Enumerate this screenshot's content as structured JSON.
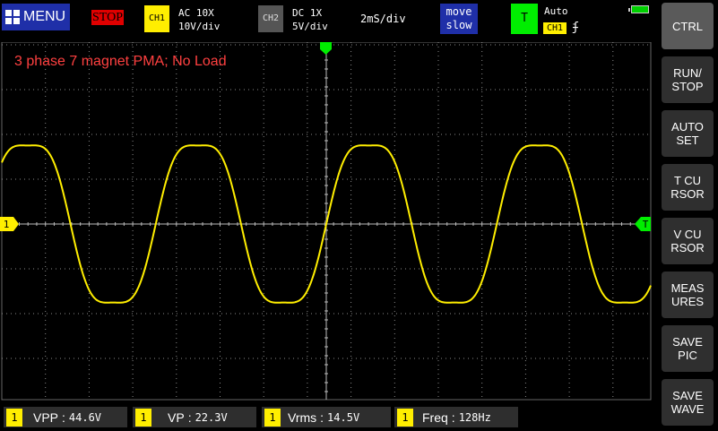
{
  "topbar": {
    "menu_label": "MENU",
    "run_state": "STOP",
    "ch1": {
      "badge": "CH1",
      "coupling": "AC  10X",
      "scale": "10V/div",
      "color": "#ffee00"
    },
    "ch2": {
      "badge": "CH2",
      "coupling": "DC  1X",
      "scale": "5V/div"
    },
    "timebase": "2mS/div",
    "move": {
      "line1": "move",
      "line2": "slow"
    },
    "trigger": {
      "badge": "T",
      "mode": "Auto",
      "source": "CH1",
      "edge_symbol": "ʄ",
      "color": "#00ee00"
    }
  },
  "plot": {
    "annotation": "3 phase 7 magnet PMA; No Load",
    "ch1_marker": "1",
    "trigger_marker": "T"
  },
  "measurements": [
    {
      "channel": "1",
      "label": "VPP",
      "value": "44.6V"
    },
    {
      "channel": "1",
      "label": "VP",
      "value": "22.3V"
    },
    {
      "channel": "1",
      "label": "Vrms",
      "value": "14.5V"
    },
    {
      "channel": "1",
      "label": "Freq",
      "value": "128Hz"
    }
  ],
  "sidebar": {
    "buttons": [
      {
        "label": "CTRL"
      },
      {
        "label": "RUN/\nSTOP"
      },
      {
        "label": "AUTO\nSET"
      },
      {
        "label": "T CU\nRSOR"
      },
      {
        "label": "V CU\nRSOR"
      },
      {
        "label": "MEAS\nURES"
      },
      {
        "label": "SAVE\nPIC"
      },
      {
        "label": "SAVE\nWAVE"
      }
    ]
  },
  "waveform": {
    "volts_per_div": 10,
    "ms_per_div": 2,
    "frequency_hz": 128,
    "peak_v": 22.3,
    "color": "#ffee00"
  }
}
